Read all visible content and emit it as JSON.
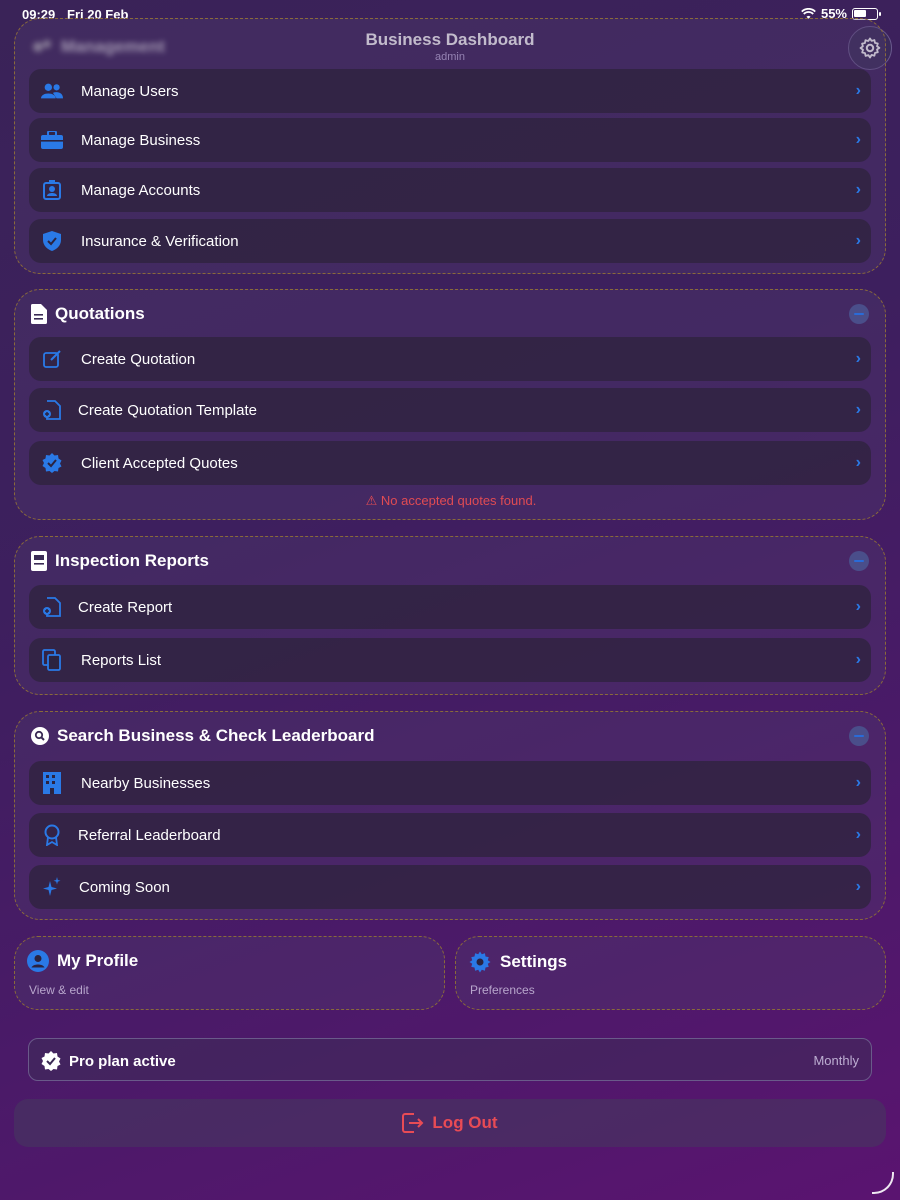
{
  "status": {
    "time": "09:29",
    "date": "Fri 20 Feb",
    "battery": "55%"
  },
  "header": {
    "title": "Business Dashboard",
    "subtitle": "admin"
  },
  "management": {
    "title": "Management",
    "items": [
      {
        "label": "Manage Users",
        "icon": "users-icon"
      },
      {
        "label": "Manage Business",
        "icon": "briefcase-icon"
      },
      {
        "label": "Manage Accounts",
        "icon": "account-icon"
      },
      {
        "label": "Insurance & Verification",
        "icon": "shield-check-icon"
      }
    ]
  },
  "quotations": {
    "title": "Quotations",
    "items": [
      {
        "label": "Create Quotation",
        "icon": "edit-icon"
      },
      {
        "label": "Create Quotation Template",
        "icon": "document-add-icon"
      },
      {
        "label": "Client Accepted Quotes",
        "icon": "badge-check-icon"
      }
    ],
    "warning": "⚠ No accepted quotes found."
  },
  "inspection": {
    "title": "Inspection Reports",
    "items": [
      {
        "label": "Create Report",
        "icon": "document-add-icon"
      },
      {
        "label": "Reports List",
        "icon": "documents-icon"
      }
    ]
  },
  "search": {
    "title": "Search Business & Check Leaderboard",
    "items": [
      {
        "label": "Nearby Businesses",
        "icon": "building-icon"
      },
      {
        "label": "Referral Leaderboard",
        "icon": "award-icon"
      },
      {
        "label": "Coming Soon",
        "icon": "sparkles-icon"
      }
    ]
  },
  "profile": {
    "title": "My Profile",
    "subtitle": "View & edit"
  },
  "settings": {
    "title": "Settings",
    "subtitle": "Preferences"
  },
  "plan": {
    "title": "Pro plan active",
    "period": "Monthly"
  },
  "logout": {
    "label": "Log Out"
  },
  "colors": {
    "accent": "#2a79e6",
    "danger": "#e84b55",
    "border": "#8a6a3a"
  }
}
